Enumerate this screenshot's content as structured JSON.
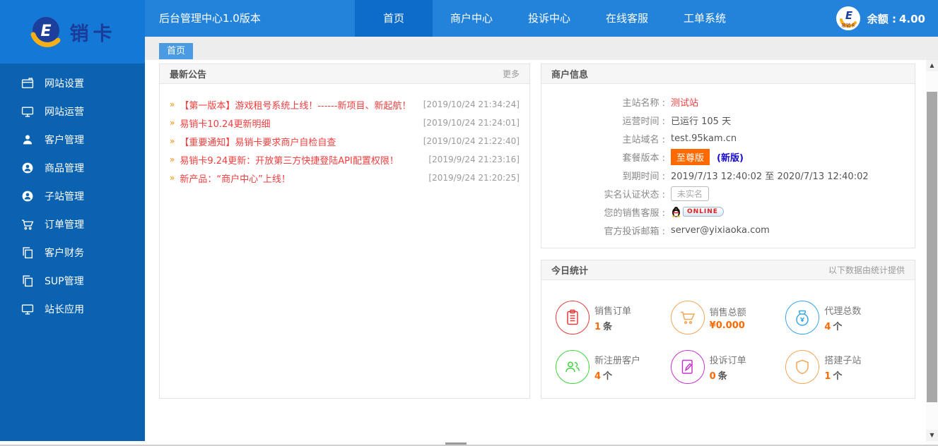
{
  "brand": {
    "logo_text": "销卡",
    "mini_logo_text": "易销卡"
  },
  "topbar": {
    "title": "后台管理中心1.0版本",
    "nav": [
      {
        "label": "首页",
        "active": true
      },
      {
        "label": "商户中心",
        "active": false
      },
      {
        "label": "投诉中心",
        "active": false
      },
      {
        "label": "在线客服",
        "active": false
      },
      {
        "label": "工单系统",
        "active": false
      }
    ],
    "balance": {
      "label": "余额 :",
      "value": "4.00"
    }
  },
  "tabbar": {
    "tabs": [
      {
        "label": "首页",
        "active": true
      }
    ]
  },
  "sidebar": {
    "items": [
      {
        "icon": "wallet-icon",
        "label": "网站设置"
      },
      {
        "icon": "monitor-icon",
        "label": "网站运营"
      },
      {
        "icon": "user-icon",
        "label": "客户管理"
      },
      {
        "icon": "user-badge-icon",
        "label": "商品管理"
      },
      {
        "icon": "user-badge-icon",
        "label": "子站管理"
      },
      {
        "icon": "cart-icon",
        "label": "订单管理"
      },
      {
        "icon": "copy-icon",
        "label": "客户财务"
      },
      {
        "icon": "copy-icon",
        "label": "SUP管理"
      },
      {
        "icon": "monitor-icon",
        "label": "站长应用"
      }
    ]
  },
  "announcements": {
    "title": "最新公告",
    "more_label": "更多",
    "arrow": "»",
    "items": [
      {
        "text": "【第一版本】游戏租号系统上线！------新项目、新起航！",
        "date": "[2019/10/24 21:34:24]"
      },
      {
        "text": "易销卡10.24更新明细",
        "date": "[2019/10/24 21:24:01]"
      },
      {
        "text": "【重要通知】易销卡要求商户自检自查",
        "date": "[2019/10/24 21:22:40]"
      },
      {
        "text": "易销卡9.24更新：开放第三方快捷登陆API配置权限！",
        "date": "[2019/9/24 21:23:16]"
      },
      {
        "text": "新产品：“商户中心”上线！",
        "date": "[2019/9/24 21:20:25]"
      }
    ]
  },
  "merchant": {
    "title": "商户信息",
    "rows": [
      {
        "label": "主站名称 :",
        "value": "测试站"
      },
      {
        "label": "运营时间 :",
        "value": "已运行 105 天"
      },
      {
        "label": "主站域名 :",
        "value": "test.95kam.cn"
      },
      {
        "label": "套餐版本 :",
        "badge": "至尊版",
        "extra": "(新版)"
      },
      {
        "label": "到期时间 :",
        "value": "2019/7/13 12:40:02 至 2020/7/13 12:40:02"
      },
      {
        "label": "实名认证状态 :",
        "tag": "未实名"
      },
      {
        "label": "您的销售客服 :",
        "qq_label": "ONLINE"
      },
      {
        "label": "官方投诉邮箱 :",
        "value": "server@yixiaoka.com"
      }
    ]
  },
  "stats": {
    "title": "今日统计",
    "note": "以下数据由统计提供",
    "cards": [
      {
        "icon": "order-icon",
        "label": "销售订单",
        "value": "1",
        "unit": "条",
        "color": "#e23c3c"
      },
      {
        "icon": "cart-icon",
        "label": "销售总额",
        "value": "¥0.000",
        "unit": "",
        "color": "#f2a658"
      },
      {
        "icon": "moneybag-icon",
        "label": "代理总数",
        "value": "4",
        "unit": "个",
        "color": "#36a5ea"
      },
      {
        "icon": "users-icon",
        "label": "新注册客户",
        "value": "4",
        "unit": "个",
        "color": "#3ed43b"
      },
      {
        "icon": "complaint-icon",
        "label": "投诉订单",
        "value": "0",
        "unit": "条",
        "color": "#c634cf"
      },
      {
        "icon": "shield-icon",
        "label": "搭建子站",
        "value": "1",
        "unit": "个",
        "color": "#f2a658"
      }
    ]
  },
  "colors": {
    "topbar_blue": "#2383da",
    "active_nav_blue": "#0d6cca",
    "logo_block_blue": "#1478d6",
    "sidebar_blue": "#0b62b1",
    "tab_blue": "#4a9be2",
    "announcement_red": "#f23d3d",
    "arrow_orange": "#ff8a00",
    "badge_orange": "#ff6a00",
    "number_orange": "#ff6a00"
  }
}
